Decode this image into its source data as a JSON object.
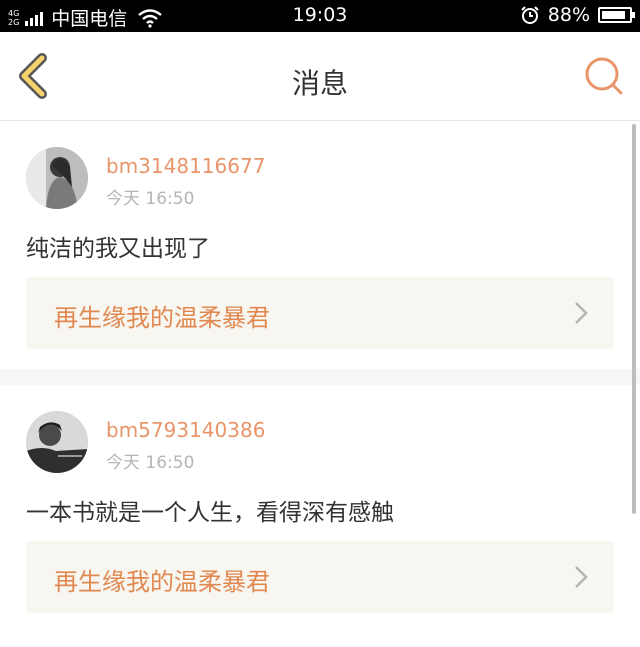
{
  "status_bar": {
    "network_top": "4G",
    "network_bottom": "2G",
    "carrier": "中国电信",
    "time": "19:03",
    "battery": "88%",
    "battery_level": 0.88,
    "icons": [
      "signal-icon",
      "wifi-icon",
      "alarm-icon",
      "battery-icon"
    ]
  },
  "header": {
    "title": "消息",
    "accent_color": "#e8956a"
  },
  "messages": [
    {
      "username": "bm3148116677",
      "time": "今天 16:50",
      "content": "纯洁的我又出现了",
      "book": "再生缘我的温柔暴君"
    },
    {
      "username": "bm5793140386",
      "time": "今天 16:50",
      "content": "一本书就是一个人生，看得深有感触",
      "book": "再生缘我的温柔暴君"
    }
  ]
}
